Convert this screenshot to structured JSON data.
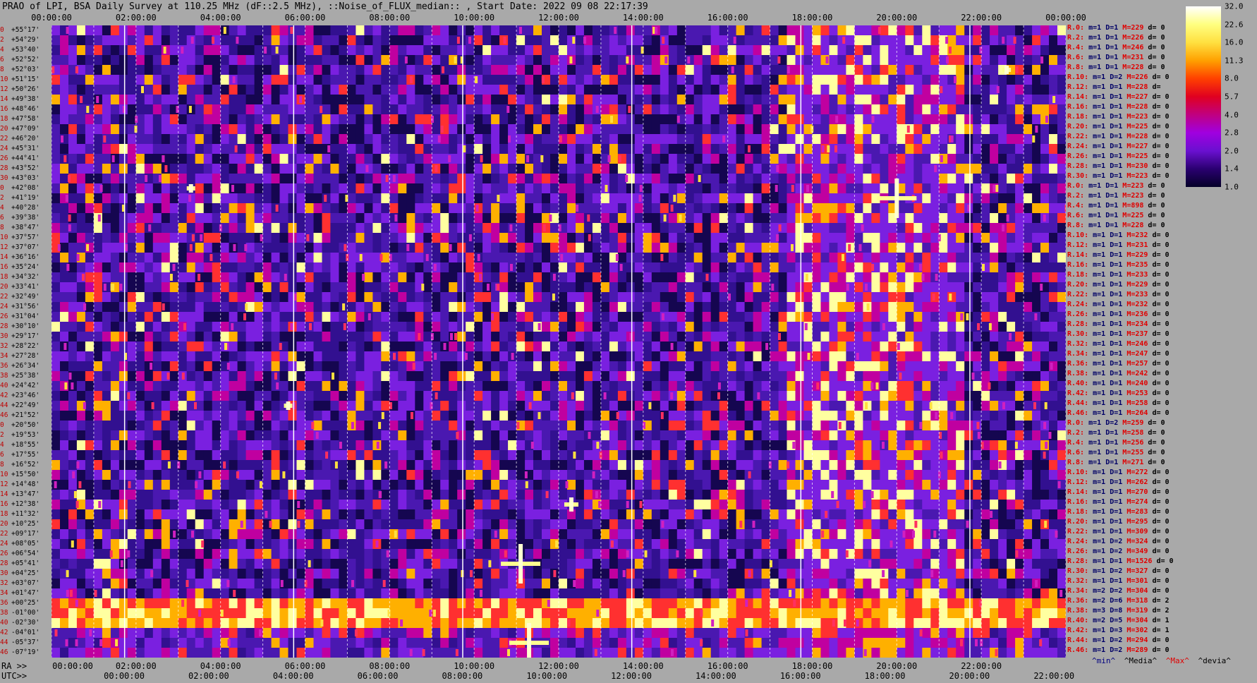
{
  "title": "PRAO of LPI, BSA Daily Survey at 110.25 MHz (dF::2.5 MHz), ::Noise_of_FLUX_median:: , Start Date: 2022 09 08 22:17:39",
  "chart_data": {
    "type": "heatmap",
    "top_axis_ticks": [
      "00:00:00",
      "02:00:00",
      "04:00:00",
      "06:00:00",
      "08:00:00",
      "10:00:00",
      "12:00:00",
      "14:00:00",
      "16:00:00",
      "18:00:00",
      "20:00:00",
      "22:00:00",
      "00:00:00"
    ],
    "ra_axis_prefix": "RA >>",
    "ra_axis_ticks": [
      "00:00:00",
      "02:00:00",
      "04:00:00",
      "06:00:00",
      "08:00:00",
      "10:00:00",
      "12:00:00",
      "14:00:00",
      "16:00:00",
      "18:00:00",
      "20:00:00",
      "22:00:00"
    ],
    "utc_axis_prefix": "UTC>>",
    "utc_axis_ticks": [
      "00:00:00",
      "02:00:00",
      "04:00:00",
      "06:00:00",
      "08:00:00",
      "10:00:00",
      "12:00:00",
      "14:00:00",
      "16:00:00",
      "18:00:00",
      "20:00:00",
      "22:00:00"
    ],
    "ra_range_hours": [
      0,
      24
    ],
    "utc_offset_hours": -1.72,
    "declinations": [
      "+55°17'",
      "+54°29'",
      "+53°40'",
      "+52°52'",
      "+52°03'",
      "+51°15'",
      "+50°26'",
      "+49°38'",
      "+48°46'",
      "+47°58'",
      "+47°09'",
      "+46°20'",
      "+45°31'",
      "+44°41'",
      "+43°52'",
      "+43°03'",
      "+42°08'",
      "+41°19'",
      "+40°28'",
      "+39°38'",
      "+38°47'",
      "+37°57'",
      "+37°07'",
      "+36°16'",
      "+35°24'",
      "+34°32'",
      "+33°41'",
      "+32°49'",
      "+31°56'",
      "+31°04'",
      "+30°10'",
      "+29°17'",
      "+28°22'",
      "+27°28'",
      "+26°34'",
      "+25°38'",
      "+24°42'",
      "+23°46'",
      "+22°49'",
      "+21°52'",
      "+20°50'",
      "+19°53'",
      "+18°55'",
      "+17°55'",
      "+16°52'",
      "+15°50'",
      "+14°48'",
      "+13°47'",
      "+12°38'",
      "+11°32'",
      "+10°25'",
      "+09°17'",
      "+08°05'",
      "+06°54'",
      "+05°41'",
      "+04°25'",
      "+03°07'",
      "+01°47'",
      "+00°25'",
      "-01°00'",
      "-02°30'",
      "-04°01'",
      "-05°37'",
      "-07°19'"
    ],
    "row_indices": [
      "0",
      "2",
      "4",
      "6",
      "8",
      "10",
      "12",
      "14",
      "16",
      "18",
      "20",
      "22",
      "24",
      "26",
      "28",
      "30",
      "0",
      "2",
      "4",
      "6",
      "8",
      "10",
      "12",
      "14",
      "16",
      "18",
      "20",
      "22",
      "24",
      "26",
      "28",
      "30",
      "32",
      "34",
      "36",
      "38",
      "40",
      "42",
      "44",
      "46",
      "0",
      "2",
      "4",
      "6",
      "8",
      "10",
      "12",
      "14",
      "16",
      "18",
      "20",
      "22",
      "24",
      "26",
      "28",
      "30",
      "32",
      "34",
      "36",
      "38",
      "40",
      "42",
      "44",
      "46"
    ],
    "colorbar": {
      "ticks": [
        "32.0",
        "22.6",
        "16.0",
        "11.3",
        "8.0",
        "5.7",
        "4.0",
        "2.8",
        "2.0",
        "1.4",
        "1.0"
      ],
      "colors": [
        "#ffffff",
        "#ffff80",
        "#ffe040",
        "#ffa000",
        "#ff4000",
        "#e00020",
        "#c00080",
        "#a000e0",
        "#6a10d0",
        "#2a0070",
        "#050028"
      ]
    },
    "bright_sources": [
      {
        "ra_h": 20.0,
        "row": 17,
        "level": 32
      },
      {
        "ra_h": 11.1,
        "row": 54,
        "level": 32
      },
      {
        "ra_h": 11.3,
        "row": 62,
        "level": 30
      },
      {
        "ra_h": 12.3,
        "row": 48,
        "level": 22
      },
      {
        "ra_h": 5.6,
        "row": 38,
        "level": 16
      },
      {
        "ra_h": 3.3,
        "row": 16,
        "level": 14
      },
      {
        "ra_h": 22.6,
        "row": 4,
        "level": 16
      }
    ],
    "band_rows": [
      58,
      59,
      60
    ],
    "band_ra_ranges": [
      [
        0,
        24
      ]
    ],
    "milky_way_ra_ranges": [
      [
        17.2,
        21.5
      ]
    ],
    "stats": [
      {
        "r": "R.0:",
        "m": "m=1",
        "d": "D=1",
        "M": "M=229",
        "dv": "d= 0"
      },
      {
        "r": "R.2:",
        "m": "m=1",
        "d": "D=1",
        "M": "M=226",
        "dv": "d= 0"
      },
      {
        "r": "R.4:",
        "m": "m=1",
        "d": "D=1",
        "M": "M=246",
        "dv": "d= 0"
      },
      {
        "r": "R.6:",
        "m": "m=1",
        "d": "D=1",
        "M": "M=231",
        "dv": "d= 0"
      },
      {
        "r": "R.8:",
        "m": "m=1",
        "d": "D=1",
        "M": "M=228",
        "dv": "d= 0"
      },
      {
        "r": "R.10:",
        "m": "m=1",
        "d": "D=2",
        "M": "M=226",
        "dv": "d= 0"
      },
      {
        "r": "R.12:",
        "m": "m=1",
        "d": "D=1",
        "M": "M=228",
        "dv": "d="
      },
      {
        "r": "R.14:",
        "m": "m=1",
        "d": "D=1",
        "M": "M=227",
        "dv": "d= 0"
      },
      {
        "r": "R.16:",
        "m": "m=1",
        "d": "D=1",
        "M": "M=228",
        "dv": "d= 0"
      },
      {
        "r": "R.18:",
        "m": "m=1",
        "d": "D=1",
        "M": "M=223",
        "dv": "d= 0"
      },
      {
        "r": "R.20:",
        "m": "m=1",
        "d": "D=1",
        "M": "M=225",
        "dv": "d= 0"
      },
      {
        "r": "R.22:",
        "m": "m=1",
        "d": "D=1",
        "M": "M=228",
        "dv": "d= 0"
      },
      {
        "r": "R.24:",
        "m": "m=1",
        "d": "D=1",
        "M": "M=227",
        "dv": "d= 0"
      },
      {
        "r": "R.26:",
        "m": "m=1",
        "d": "D=1",
        "M": "M=225",
        "dv": "d= 0"
      },
      {
        "r": "R.28:",
        "m": "m=1",
        "d": "D=1",
        "M": "M=230",
        "dv": "d= 0"
      },
      {
        "r": "R.30:",
        "m": "m=1",
        "d": "D=1",
        "M": "M=223",
        "dv": "d= 0"
      },
      {
        "r": "R.0:",
        "m": "m=1",
        "d": "D=1",
        "M": "M=223",
        "dv": "d= 0"
      },
      {
        "r": "R.2:",
        "m": "m=1",
        "d": "D=1",
        "M": "M=223",
        "dv": "d= 0"
      },
      {
        "r": "R.4:",
        "m": "m=1",
        "d": "D=1",
        "M": "M=898",
        "dv": "d= 0"
      },
      {
        "r": "R.6:",
        "m": "m=1",
        "d": "D=1",
        "M": "M=225",
        "dv": "d= 0"
      },
      {
        "r": "R.8:",
        "m": "m=1",
        "d": "D=1",
        "M": "M=228",
        "dv": "d= 0"
      },
      {
        "r": "R.10:",
        "m": "m=1",
        "d": "D=1",
        "M": "M=232",
        "dv": "d= 0"
      },
      {
        "r": "R.12:",
        "m": "m=1",
        "d": "D=1",
        "M": "M=231",
        "dv": "d= 0"
      },
      {
        "r": "R.14:",
        "m": "m=1",
        "d": "D=1",
        "M": "M=229",
        "dv": "d= 0"
      },
      {
        "r": "R.16:",
        "m": "m=1",
        "d": "D=1",
        "M": "M=235",
        "dv": "d= 0"
      },
      {
        "r": "R.18:",
        "m": "m=1",
        "d": "D=1",
        "M": "M=233",
        "dv": "d= 0"
      },
      {
        "r": "R.20:",
        "m": "m=1",
        "d": "D=1",
        "M": "M=229",
        "dv": "d= 0"
      },
      {
        "r": "R.22:",
        "m": "m=1",
        "d": "D=1",
        "M": "M=233",
        "dv": "d= 0"
      },
      {
        "r": "R.24:",
        "m": "m=1",
        "d": "D=1",
        "M": "M=232",
        "dv": "d= 0"
      },
      {
        "r": "R.26:",
        "m": "m=1",
        "d": "D=1",
        "M": "M=236",
        "dv": "d= 0"
      },
      {
        "r": "R.28:",
        "m": "m=1",
        "d": "D=1",
        "M": "M=234",
        "dv": "d= 0"
      },
      {
        "r": "R.30:",
        "m": "m=1",
        "d": "D=1",
        "M": "M=237",
        "dv": "d= 0"
      },
      {
        "r": "R.32:",
        "m": "m=1",
        "d": "D=1",
        "M": "M=246",
        "dv": "d= 0"
      },
      {
        "r": "R.34:",
        "m": "m=1",
        "d": "D=1",
        "M": "M=247",
        "dv": "d= 0"
      },
      {
        "r": "R.36:",
        "m": "m=1",
        "d": "D=1",
        "M": "M=257",
        "dv": "d= 0"
      },
      {
        "r": "R.38:",
        "m": "m=1",
        "d": "D=1",
        "M": "M=242",
        "dv": "d= 0"
      },
      {
        "r": "R.40:",
        "m": "m=1",
        "d": "D=1",
        "M": "M=240",
        "dv": "d= 0"
      },
      {
        "r": "R.42:",
        "m": "m=1",
        "d": "D=1",
        "M": "M=253",
        "dv": "d= 0"
      },
      {
        "r": "R.44:",
        "m": "m=1",
        "d": "D=1",
        "M": "M=258",
        "dv": "d= 0"
      },
      {
        "r": "R.46:",
        "m": "m=1",
        "d": "D=1",
        "M": "M=264",
        "dv": "d= 0"
      },
      {
        "r": "R.0:",
        "m": "m=1",
        "d": "D=2",
        "M": "M=259",
        "dv": "d= 0"
      },
      {
        "r": "R.2:",
        "m": "m=1",
        "d": "D=1",
        "M": "M=258",
        "dv": "d= 0"
      },
      {
        "r": "R.4:",
        "m": "m=1",
        "d": "D=1",
        "M": "M=256",
        "dv": "d= 0"
      },
      {
        "r": "R.6:",
        "m": "m=1",
        "d": "D=1",
        "M": "M=255",
        "dv": "d= 0"
      },
      {
        "r": "R.8:",
        "m": "m=1",
        "d": "D=1",
        "M": "M=271",
        "dv": "d= 0"
      },
      {
        "r": "R.10:",
        "m": "m=1",
        "d": "D=1",
        "M": "M=272",
        "dv": "d= 0"
      },
      {
        "r": "R.12:",
        "m": "m=1",
        "d": "D=1",
        "M": "M=262",
        "dv": "d= 0"
      },
      {
        "r": "R.14:",
        "m": "m=1",
        "d": "D=1",
        "M": "M=270",
        "dv": "d= 0"
      },
      {
        "r": "R.16:",
        "m": "m=1",
        "d": "D=1",
        "M": "M=274",
        "dv": "d= 0"
      },
      {
        "r": "R.18:",
        "m": "m=1",
        "d": "D=1",
        "M": "M=283",
        "dv": "d= 0"
      },
      {
        "r": "R.20:",
        "m": "m=1",
        "d": "D=1",
        "M": "M=295",
        "dv": "d= 0"
      },
      {
        "r": "R.22:",
        "m": "m=1",
        "d": "D=1",
        "M": "M=309",
        "dv": "d= 0"
      },
      {
        "r": "R.24:",
        "m": "m=1",
        "d": "D=2",
        "M": "M=324",
        "dv": "d= 0"
      },
      {
        "r": "R.26:",
        "m": "m=1",
        "d": "D=2",
        "M": "M=349",
        "dv": "d= 0"
      },
      {
        "r": "R.28:",
        "m": "m=1",
        "d": "D=1",
        "M": "M=1526",
        "dv": "d= 0"
      },
      {
        "r": "R.30:",
        "m": "m=1",
        "d": "D=2",
        "M": "M=327",
        "dv": "d= 0"
      },
      {
        "r": "R.32:",
        "m": "m=1",
        "d": "D=1",
        "M": "M=301",
        "dv": "d= 0"
      },
      {
        "r": "R.34:",
        "m": "m=2",
        "d": "D=2",
        "M": "M=304",
        "dv": "d= 0"
      },
      {
        "r": "R.36:",
        "m": "m=2",
        "d": "D=6",
        "M": "M=318",
        "dv": "d= 2"
      },
      {
        "r": "R.38:",
        "m": "m=3",
        "d": "D=8",
        "M": "M=319",
        "dv": "d= 2"
      },
      {
        "r": "R.40:",
        "m": "m=2",
        "d": "D=5",
        "M": "M=304",
        "dv": "d= 1"
      },
      {
        "r": "R.42:",
        "m": "m=1",
        "d": "D=3",
        "M": "M=302",
        "dv": "d= 1"
      },
      {
        "r": "R.44:",
        "m": "m=1",
        "d": "D=2",
        "M": "M=294",
        "dv": "d= 0"
      },
      {
        "r": "R.46:",
        "m": "m=1",
        "d": "D=2",
        "M": "M=289",
        "dv": "d= 0"
      }
    ],
    "footer": {
      "min": "^min^",
      "median": "^Media^",
      "max": "^Max^",
      "devia": "^devia^"
    }
  }
}
